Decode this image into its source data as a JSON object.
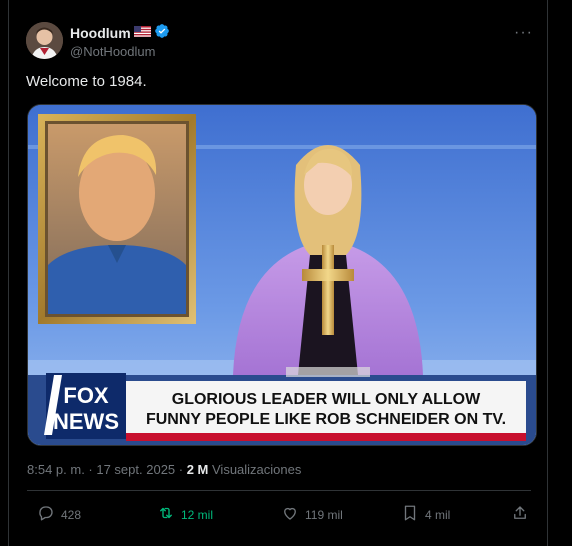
{
  "author": {
    "display_name": "Hoodlum",
    "flag": "🇺🇸",
    "handle": "@NotHoodlum",
    "verified": true
  },
  "tweet": {
    "text": "Welcome to 1984."
  },
  "media": {
    "ticker_line1": "GLORIOUS LEADER WILL ONLY ALLOW",
    "ticker_line2": "FUNNY PEOPLE LIKE ROB SCHNEIDER ON TV.",
    "logo_top": "FOX",
    "logo_bottom": "NEWS"
  },
  "meta": {
    "time": "8:54 p. m. · 17 sept. 2025 · ",
    "views_count": "2 M",
    "views_label": "Visualizaciones"
  },
  "actions": {
    "replies": "428",
    "reposts": "12 mil",
    "likes": "119 mil",
    "bookmarks": "4 mil"
  },
  "colors": {
    "accent": "#1d9bf0",
    "repost": "#00ba7c",
    "muted": "#71767b"
  }
}
